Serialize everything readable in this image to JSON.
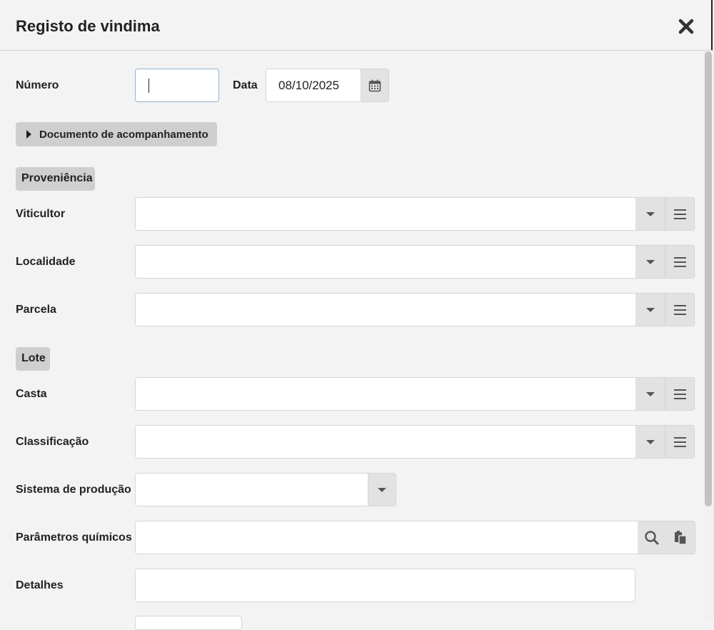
{
  "dialog": {
    "title": "Registo de vindima",
    "close_icon": "close-icon"
  },
  "form": {
    "numero_label": "Número",
    "numero_value": "",
    "data_label": "Data",
    "data_value": "08/10/2025",
    "calendar_icon": "calendar-icon",
    "documento_toggle": "Documento de acompanhamento",
    "sections": {
      "proveniencia": "Proveniência",
      "lote": "Lote"
    },
    "fields": {
      "viticultor": "Viticultor",
      "localidade": "Localidade",
      "parcela": "Parcela",
      "casta": "Casta",
      "classificacao": "Classificação",
      "sistema_producao": "Sistema de produção",
      "parametros_quimicos": "Parâmetros químicos",
      "detalhes": "Detalhes"
    }
  }
}
